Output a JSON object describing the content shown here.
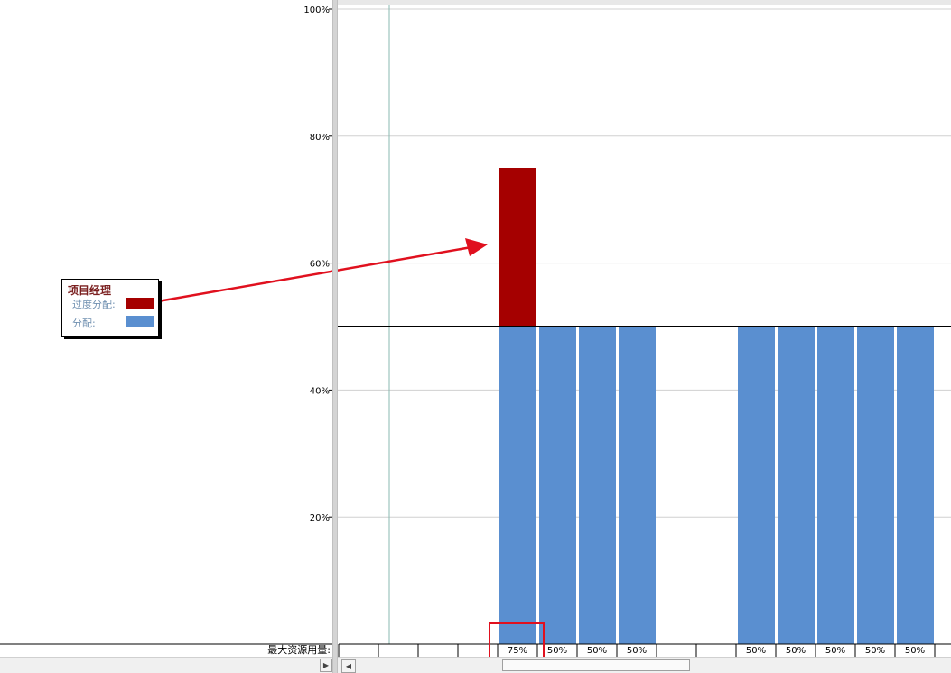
{
  "chart_data": {
    "type": "bar",
    "ylabel": "",
    "ylim": [
      0,
      100
    ],
    "y_ticks": [
      "20%",
      "40%",
      "60%",
      "80%",
      "100%"
    ],
    "y_tick_values": [
      20,
      40,
      60,
      80,
      100
    ],
    "max_units": 50,
    "slots": 15,
    "bars": [
      {
        "slot": 4,
        "allocated": 50,
        "overallocated": 25
      },
      {
        "slot": 5,
        "allocated": 50,
        "overallocated": 0
      },
      {
        "slot": 6,
        "allocated": 50,
        "overallocated": 0
      },
      {
        "slot": 7,
        "allocated": 50,
        "overallocated": 0
      },
      {
        "slot": 10,
        "allocated": 50,
        "overallocated": 0
      },
      {
        "slot": 11,
        "allocated": 50,
        "overallocated": 0
      },
      {
        "slot": 12,
        "allocated": 50,
        "overallocated": 0
      },
      {
        "slot": 13,
        "allocated": 50,
        "overallocated": 0
      },
      {
        "slot": 14,
        "allocated": 50,
        "overallocated": 0
      }
    ],
    "row_label": "最大资源用量:",
    "row_values": [
      "",
      "",
      "",
      "",
      "75%",
      "50%",
      "50%",
      "50%",
      "",
      "",
      "50%",
      "50%",
      "50%",
      "50%",
      "50%"
    ],
    "grid": true
  },
  "legend": {
    "title": "项目经理",
    "overallocated_label": "过度分配:",
    "allocated_label": "分配:"
  },
  "colors": {
    "overallocated": "#a50000",
    "allocated": "#5a8fd0",
    "annotation": "#e0101e"
  }
}
